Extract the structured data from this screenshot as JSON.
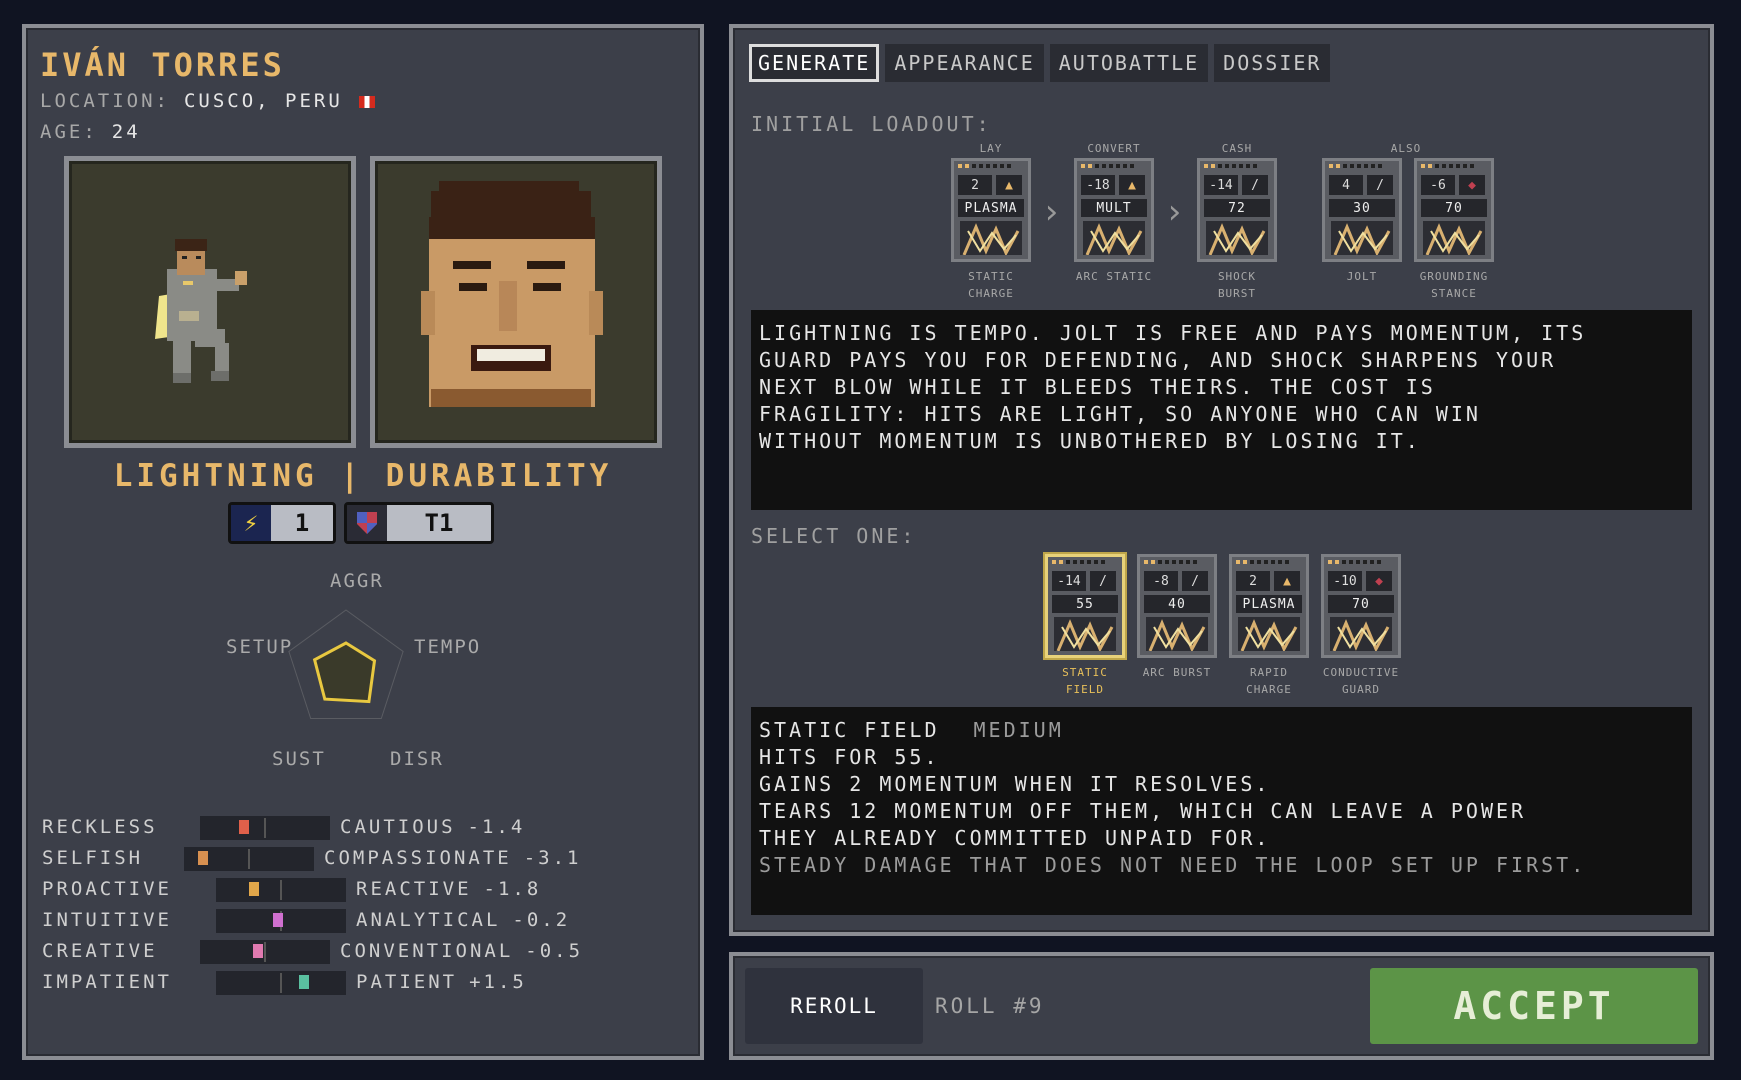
{
  "character": {
    "name": "IVÁN TORRES",
    "location_label": "LOCATION:",
    "location": "CUSCO, PERU",
    "age_label": "AGE:",
    "age": "24",
    "type_title": "LIGHTNING | DURABILITY",
    "badges": [
      {
        "icon": "lightning-icon",
        "value": "1"
      },
      {
        "icon": "shield-icon",
        "value": "T1"
      }
    ],
    "radar": {
      "labels": [
        "AGGR",
        "TEMPO",
        "DISR",
        "SUST",
        "SETUP"
      ],
      "values": [
        0.45,
        0.5,
        0.65,
        0.6,
        0.55
      ]
    },
    "traits": [
      {
        "left": "RECKLESS",
        "right": "CAUTIOUS",
        "value": "-1.4",
        "score": -1.4,
        "color": "#e0604a"
      },
      {
        "left": "SELFISH",
        "right": "COMPASSIONATE",
        "value": "-3.1",
        "score": -3.1,
        "color": "#d89050"
      },
      {
        "left": "PROACTIVE",
        "right": "REACTIVE",
        "value": "-1.8",
        "score": -1.8,
        "color": "#e0a64a"
      },
      {
        "left": "INTUITIVE",
        "right": "ANALYTICAL",
        "value": "-0.2",
        "score": -0.2,
        "color": "#d070d0"
      },
      {
        "left": "CREATIVE",
        "right": "CONVENTIONAL",
        "value": "-0.5",
        "score": -0.5,
        "color": "#e07ab0"
      },
      {
        "left": "IMPATIENT",
        "right": "PATIENT",
        "value": "+1.5",
        "score": 1.5,
        "color": "#5ac0a0"
      }
    ]
  },
  "tabs": [
    "GENERATE",
    "APPEARANCE",
    "AUTOBATTLE",
    "DOSSIER"
  ],
  "active_tab": "GENERATE",
  "loadout": {
    "label": "INITIAL LOADOUT:",
    "groups": [
      "LAY",
      "CONVERT",
      "CASH",
      "ALSO"
    ],
    "cards": [
      {
        "pips": 2,
        "cost": "2",
        "sym": "flame-icon",
        "value": "PLASMA",
        "name": [
          "STATIC",
          "CHARGE"
        ]
      },
      {
        "pips": 2,
        "cost": "-18",
        "sym": "flame-icon",
        "value": "MULT",
        "name": [
          "ARC STATIC"
        ]
      },
      {
        "pips": 2,
        "cost": "-14",
        "sym": "sword-icon",
        "value": "72",
        "name": [
          "SHOCK",
          "BURST"
        ]
      },
      {
        "pips": 2,
        "cost": "4",
        "sym": "sword-icon",
        "value": "30",
        "name": [
          "JOLT"
        ]
      },
      {
        "pips": 2,
        "cost": "-6",
        "sym": "shield-icon",
        "value": "70",
        "name": [
          "GROUNDING",
          "STANCE"
        ]
      }
    ],
    "description": [
      "LIGHTNING IS TEMPO. JOLT IS FREE AND PAYS MOMENTUM, ITS",
      "GUARD PAYS YOU FOR DEFENDING, AND SHOCK SHARPENS YOUR",
      "NEXT BLOW WHILE IT BLEEDS THEIRS. THE COST IS",
      "FRAGILITY: HITS ARE LIGHT, SO ANYONE WHO CAN WIN",
      "WITHOUT MOMENTUM IS UNBOTHERED BY LOSING IT."
    ]
  },
  "select": {
    "label": "SELECT ONE:",
    "cards": [
      {
        "pips": 2,
        "cost": "-14",
        "sym": "sword-icon",
        "value": "55",
        "name": [
          "STATIC",
          "FIELD"
        ],
        "selected": true
      },
      {
        "pips": 2,
        "cost": "-8",
        "sym": "sword-icon",
        "value": "40",
        "name": [
          "ARC BURST"
        ]
      },
      {
        "pips": 2,
        "cost": "2",
        "sym": "flame-icon",
        "value": "PLASMA",
        "name": [
          "RAPID",
          "CHARGE"
        ]
      },
      {
        "pips": 2,
        "cost": "-10",
        "sym": "shield-icon",
        "value": "70",
        "name": [
          "CONDUCTIVE",
          "GUARD"
        ]
      }
    ],
    "detail": {
      "title": "STATIC FIELD",
      "tag": "MEDIUM",
      "lines": [
        "HITS FOR 55.",
        "GAINS 2 MOMENTUM WHEN IT RESOLVES.",
        "TEARS 12 MOMENTUM OFF THEM, WHICH CAN LEAVE A POWER",
        "THEY ALREADY COMMITTED UNPAID FOR."
      ],
      "note": "STEADY DAMAGE THAT DOES NOT NEED THE LOOP SET UP FIRST."
    }
  },
  "footer": {
    "reroll": "REROLL",
    "roll": "ROLL #9",
    "accept": "ACCEPT"
  }
}
